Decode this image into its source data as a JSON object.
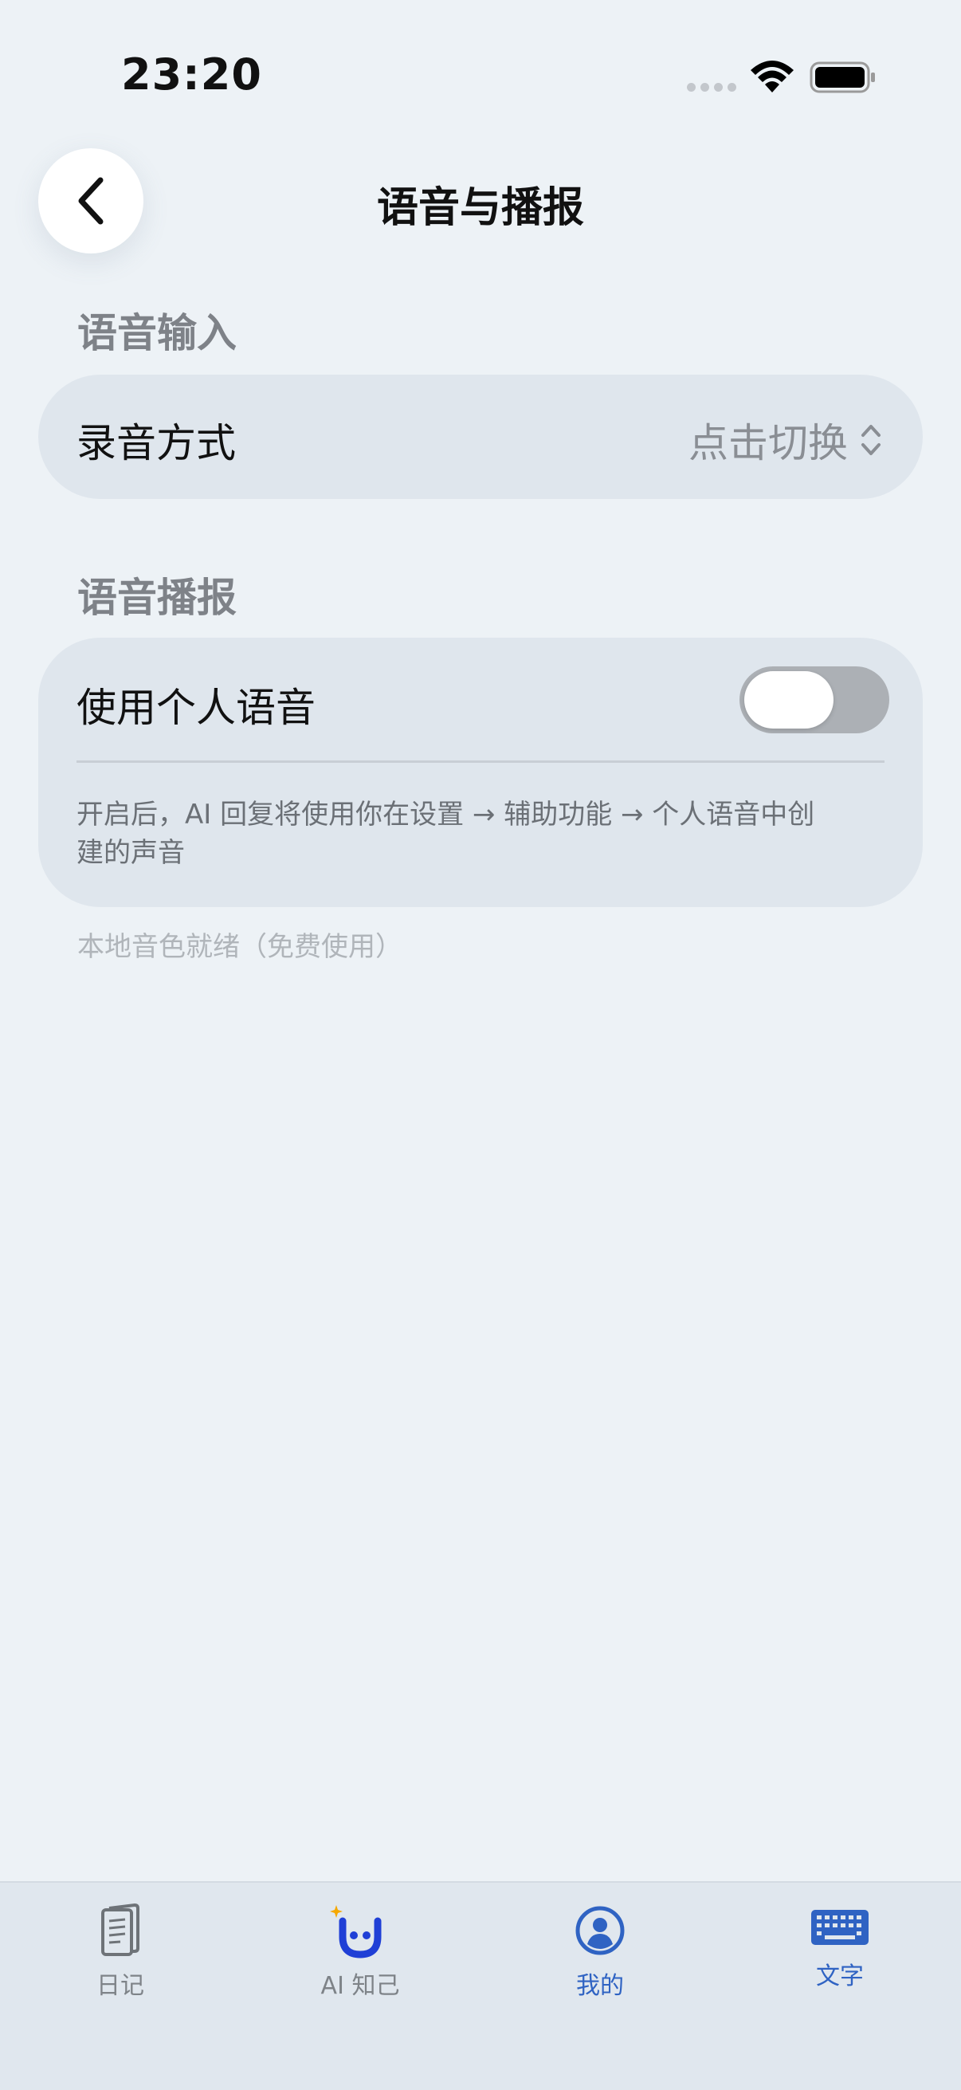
{
  "status_bar": {
    "time": "23:20",
    "wifi_icon": "wifi-icon",
    "battery_icon": "battery-icon"
  },
  "header": {
    "title": "语音与播报",
    "back_icon": "chevron-left-icon"
  },
  "voice_input": {
    "section_title": "语音输入",
    "recording_mode": {
      "label": "录音方式",
      "value": "点击切换",
      "icon": "chevron-up-down-icon"
    }
  },
  "voice_broadcast": {
    "section_title": "语音播报",
    "personal_voice": {
      "label": "使用个人语音",
      "enabled": false,
      "description": "开启后，AI 回复将使用你在设置 → 辅助功能 → 个人语音中创建的声音"
    },
    "footer_note": "本地音色就绪（免费使用）"
  },
  "tab_bar": {
    "items": [
      {
        "label": "日记",
        "icon": "diary-icon"
      },
      {
        "label": "AI 知己",
        "icon": "ai-smile-icon"
      },
      {
        "label": "我的",
        "icon": "profile-icon"
      },
      {
        "label": "文字",
        "icon": "keyboard-icon"
      }
    ]
  },
  "colors": {
    "background": "#edf2f6",
    "card": "#dfe6ed",
    "accent_blue": "#2f63c3",
    "ai_blue": "#1f3fd6",
    "star_yellow": "#f5a800"
  }
}
